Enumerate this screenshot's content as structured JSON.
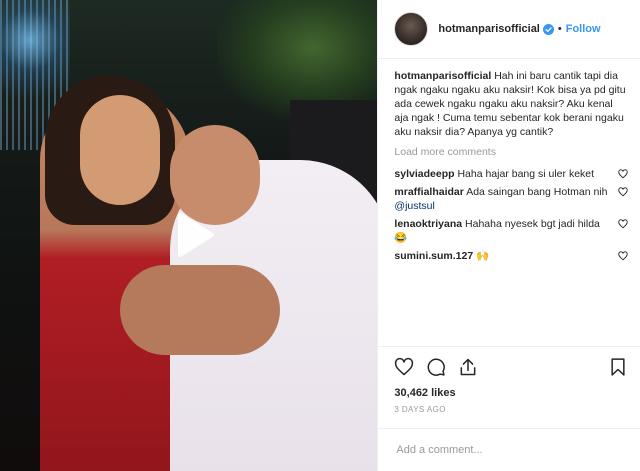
{
  "post": {
    "username": "hotmanparisofficial",
    "separator": "•",
    "follow_label": "Follow",
    "caption": "Hah ini baru cantik tapi dia ngak ngaku ngaku aku naksir! Kok bisa ya pd gitu ada cewek ngaku ngaku aku naksir? Aku kenal aja ngak ! Cuma temu sebentar kok berani ngaku aku naksir dia? Apanya yg cantik?",
    "load_more": "Load more comments",
    "comments": [
      {
        "user": "sylviadeepp",
        "text": "Haha hajar bang si uler keket",
        "mention": ""
      },
      {
        "user": "mraffialhaidar",
        "text": "Ada saingan bang Hotman nih ",
        "mention": "@justsul"
      },
      {
        "user": "lenaoktriyana",
        "text": "Hahaha nyesek bgt jadi hilda 😂",
        "mention": ""
      },
      {
        "user": "sumini.sum.127",
        "text": "🙌",
        "mention": ""
      }
    ],
    "likes": "30,462 likes",
    "time_ago": "3 DAYS AGO",
    "add_comment_placeholder": "Add a comment..."
  },
  "colors": {
    "link_blue": "#3897f0",
    "muted": "#999999",
    "text": "#262626",
    "border": "#efefef"
  },
  "icons": {
    "verified": "verified-badge-icon",
    "play": "play-icon",
    "like": "heart-icon",
    "comment": "comment-bubble-icon",
    "share": "share-arrow-icon",
    "save": "bookmark-icon"
  }
}
